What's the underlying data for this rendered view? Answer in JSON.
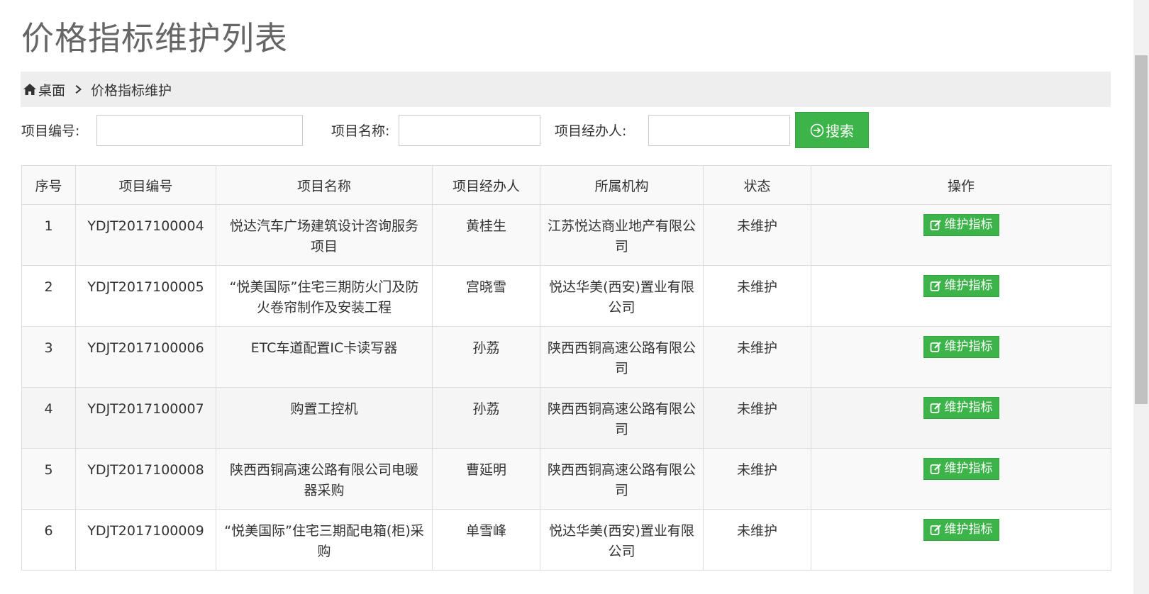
{
  "page": {
    "title": "价格指标维护列表"
  },
  "breadcrumb": {
    "home": "桌面",
    "current": "价格指标维护"
  },
  "search": {
    "code_label": "项目编号:",
    "name_label": "项目名称:",
    "manager_label": "项目经办人:",
    "button_label": "搜索",
    "code_value": "",
    "name_value": "",
    "manager_value": ""
  },
  "table": {
    "headers": [
      "序号",
      "项目编号",
      "项目名称",
      "项目经办人",
      "所属机构",
      "状态",
      "操作"
    ],
    "rows": [
      {
        "index": "1",
        "code": "YDJT2017100004",
        "name": "悦达汽车广场建筑设计咨询服务项目",
        "manager": "黄桂生",
        "org": "江苏悦达商业地产有限公司",
        "status": "未维护",
        "action": "维护指标"
      },
      {
        "index": "2",
        "code": "YDJT2017100005",
        "name": "“悦美国际”住宅三期防火门及防火卷帘制作及安装工程",
        "manager": "宫晓雪",
        "org": "悦达华美(西安)置业有限公司",
        "status": "未维护",
        "action": "维护指标"
      },
      {
        "index": "3",
        "code": "YDJT2017100006",
        "name": "ETC车道配置IC卡读写器",
        "manager": "孙荔",
        "org": "陕西西铜高速公路有限公司",
        "status": "未维护",
        "action": "维护指标"
      },
      {
        "index": "4",
        "code": "YDJT2017100007",
        "name": "购置工控机",
        "manager": "孙荔",
        "org": "陕西西铜高速公路有限公司",
        "status": "未维护",
        "action": "维护指标"
      },
      {
        "index": "5",
        "code": "YDJT2017100008",
        "name": "陕西西铜高速公路有限公司电暖器采购",
        "manager": "曹延明",
        "org": "陕西西铜高速公路有限公司",
        "status": "未维护",
        "action": "维护指标"
      },
      {
        "index": "6",
        "code": "YDJT2017100009",
        "name": "“悦美国际”住宅三期配电箱(柜)采购",
        "manager": "单雪峰",
        "org": "悦达华美(西安)置业有限公司",
        "status": "未维护",
        "action": "维护指标"
      }
    ]
  },
  "colors": {
    "accent_green": "#3cb44a",
    "breadcrumb_bg": "#eeeeee",
    "title_gray": "#666666"
  },
  "icons": {
    "home": "home-icon",
    "breadcrumb_separator": "chevron-right-icon",
    "search": "circle-arrow-icon",
    "maintain": "edit-icon"
  }
}
